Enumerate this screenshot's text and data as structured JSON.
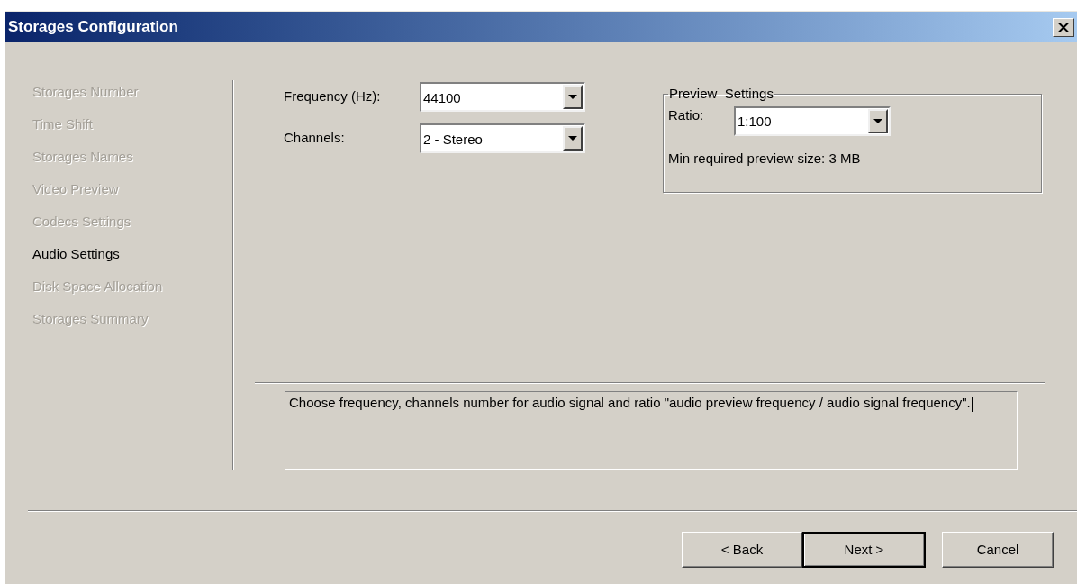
{
  "window": {
    "title": "Storages Configuration"
  },
  "steps": [
    {
      "label": "Storages Number",
      "selected": false
    },
    {
      "label": "Time Shift",
      "selected": false
    },
    {
      "label": "Storages Names",
      "selected": false
    },
    {
      "label": "Video Preview",
      "selected": false
    },
    {
      "label": "Codecs Settings",
      "selected": false
    },
    {
      "label": "Audio Settings",
      "selected": true
    },
    {
      "label": "Disk Space Allocation",
      "selected": false
    },
    {
      "label": "Storages Summary",
      "selected": false
    }
  ],
  "fields": [
    {
      "label": "Frequency (Hz):",
      "value": "44100"
    },
    {
      "label": "Channels:",
      "value": "2 - Stereo"
    }
  ],
  "preview_settings": {
    "title": "Preview  Settings",
    "ratio_label": "Ratio:",
    "ratio_value": "1:100",
    "info": "Min required preview size: 3 MB"
  },
  "description": "Choose frequency, channels number for audio signal and ratio \"audio preview frequency / audio signal frequency\".",
  "buttons": [
    {
      "label": "< Back",
      "default": false
    },
    {
      "label": "Next >",
      "default": true
    },
    {
      "label": "Cancel",
      "default": false
    }
  ]
}
